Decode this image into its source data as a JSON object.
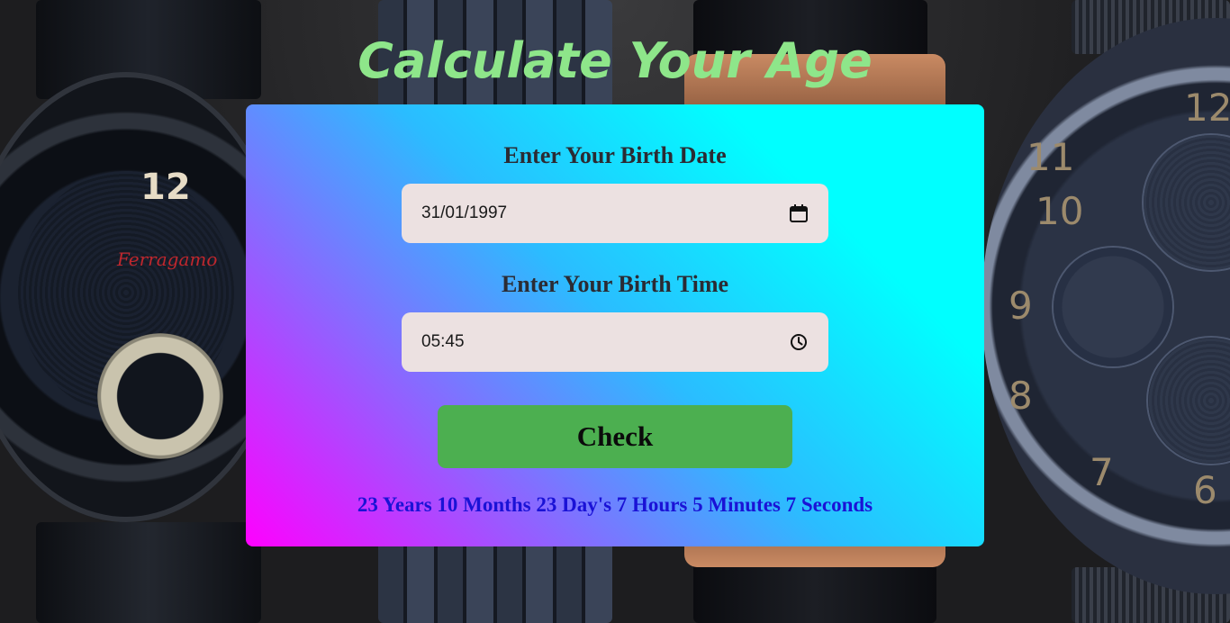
{
  "page": {
    "title": "Calculate Your Age"
  },
  "form": {
    "date_label": "Enter Your Birth Date",
    "date_value": "31/01/1997",
    "time_label": "Enter Your Birth Time",
    "time_value": "05:45",
    "check_label": "Check"
  },
  "result": {
    "text": "23 Years 10 Months 23 Day's 7 Hours 5 Minutes 7 Seconds"
  },
  "background_decor": {
    "left_watch_brand": "Ferragamo",
    "left_watch_numeral": "12",
    "right_watch_numerals": [
      "11",
      "10",
      "9",
      "8",
      "7",
      "12",
      "6"
    ]
  },
  "icons": {
    "date": "calendar-icon",
    "time": "clock-icon"
  },
  "colors": {
    "title": "#8ee68a",
    "button": "#4caf50",
    "result_text": "#1a12d6",
    "input_bg": "#ece1e1",
    "card_gradient_start": "#ff00ff",
    "card_gradient_end": "#00ffff"
  }
}
